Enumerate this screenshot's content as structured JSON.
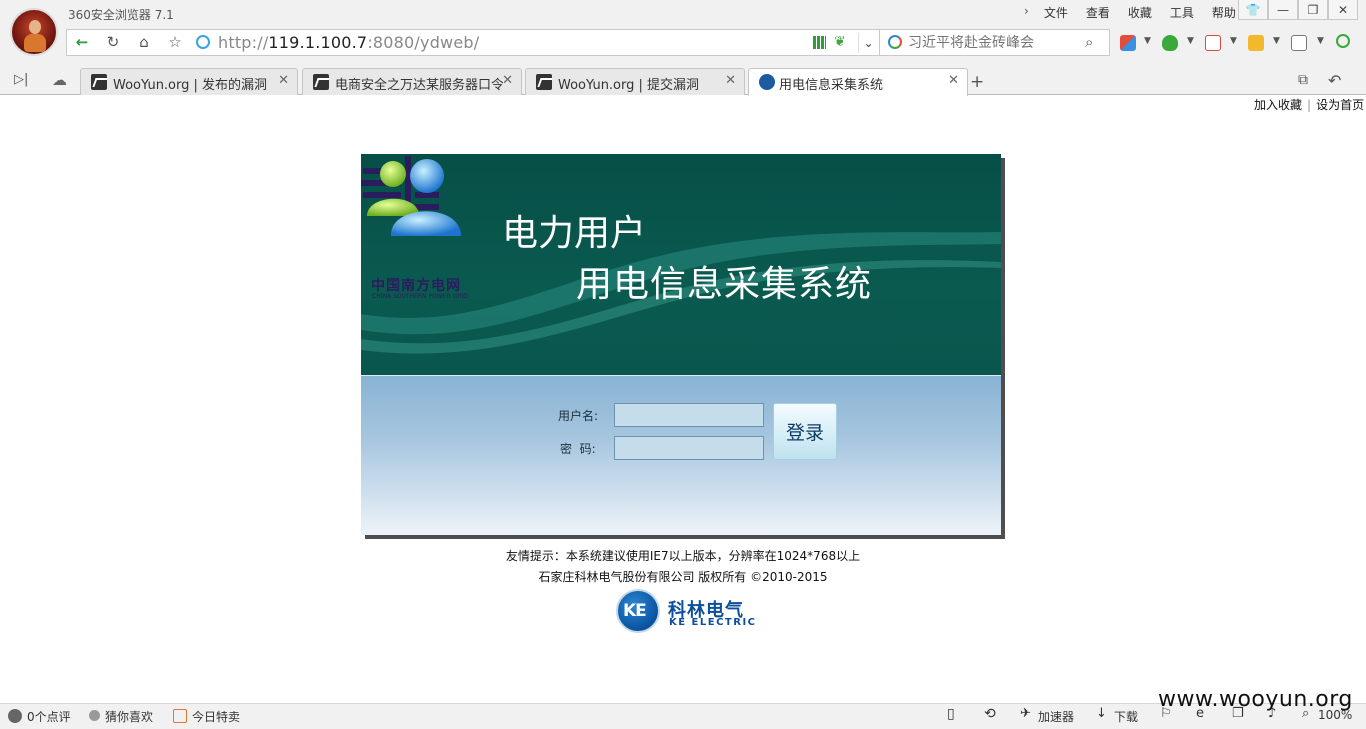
{
  "browser": {
    "title": "360安全浏览器 7.1",
    "menu": [
      "文件",
      "查看",
      "收藏",
      "工具",
      "帮助"
    ],
    "url_host": "119.1.100.7",
    "url_prefix": "http://",
    "url_rest": ":8080/ydweb/",
    "search_placeholder": "习近平将赴金砖峰会",
    "tabs": [
      {
        "label": "WooYun.org | 发布的漏洞"
      },
      {
        "label": "电商安全之万达某服务器口令导"
      },
      {
        "label": "WooYun.org | 提交漏洞"
      },
      {
        "label": "用电信息采集系统"
      }
    ]
  },
  "page": {
    "top_links": {
      "favorite": "加入收藏",
      "sep": "|",
      "homepage": "设为首页"
    },
    "logo_cn": "中国南方电网",
    "logo_en": "CHINA SOUTHERN POWER GRID",
    "title_line1": "电力用户",
    "title_line2": "用电信息采集系统",
    "form": {
      "username_label": "用户名:",
      "password_label": "密  码:",
      "username_value": "",
      "password_value": "",
      "login_button": "登录"
    },
    "tip": "友情提示：本系统建议使用IE7以上版本，分辨率在1024*768以上",
    "copyright": "石家庄科林电气股份有限公司 版权所有 ©2010-2015",
    "company_logo_text": "KE",
    "company_cn": "科林电气",
    "company_en": "KE ELECTRIC"
  },
  "statusbar": {
    "reviews": "0个点评",
    "guess": "猜你喜欢",
    "deals": "今日特卖",
    "accelerator": "加速器",
    "download": "下载",
    "zoom": "100%"
  },
  "watermark": "www.wooyun.org",
  "colors": {
    "banner": "#064f47",
    "accent_blue": "#0d4f9a",
    "login_bg": "#a7c6df"
  }
}
